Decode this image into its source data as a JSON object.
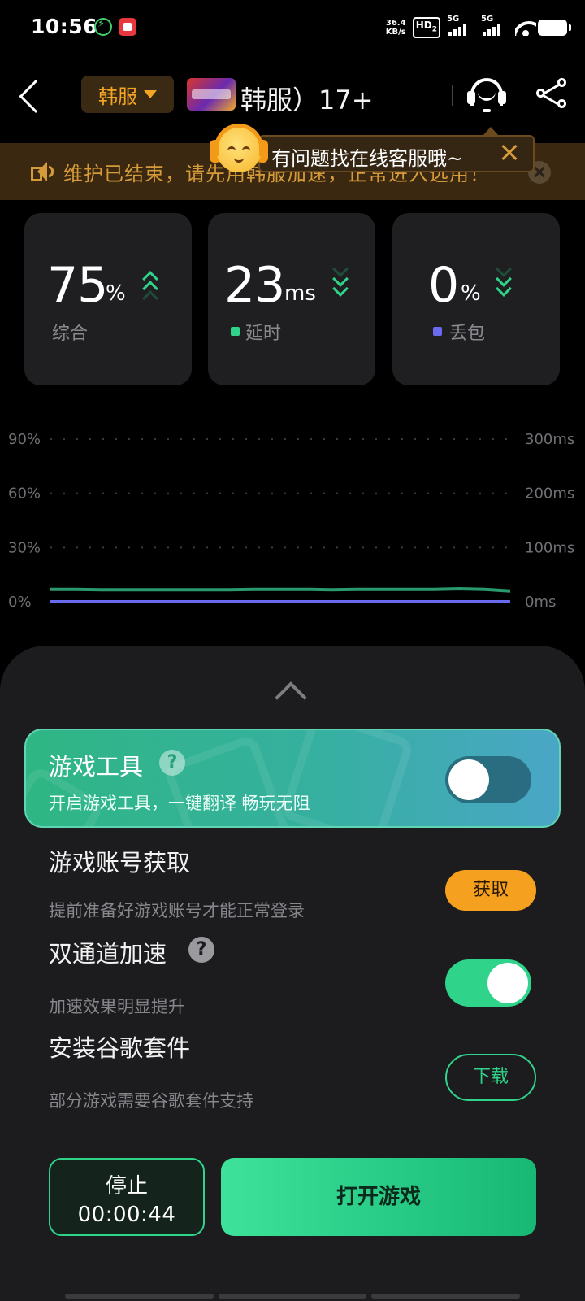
{
  "status_bar": {
    "time": "10:56",
    "net_speed_value": "36.4",
    "net_speed_unit": "KB/s",
    "hd_label": "HD",
    "hd_sub": "2",
    "sim1_label": "5G",
    "sim2_label": "5G"
  },
  "header": {
    "region_label": "韩服",
    "game_title": "韩服）17+",
    "notice_text": "维护已结束，请先用韩服加速，正常进入选用！"
  },
  "tooltip": {
    "text": "有问题找在线客服哦~"
  },
  "stats": [
    {
      "value": "75",
      "unit": "%",
      "label": "综合",
      "trend": "up",
      "color": ""
    },
    {
      "value": "23",
      "unit": "ms",
      "label": "延时",
      "trend": "down",
      "color": "#2fd38a"
    },
    {
      "value": "0",
      "unit": "%",
      "label": "丢包",
      "trend": "down",
      "color": "#6a6af0"
    }
  ],
  "chart_data": {
    "type": "line",
    "left_axis_ticks": [
      "90%",
      "60%",
      "30%",
      "0%"
    ],
    "right_axis_ticks": [
      "300ms",
      "200ms",
      "100ms",
      "0ms"
    ],
    "left_ylim": [
      0,
      90
    ],
    "right_ylim": [
      0,
      300
    ],
    "grid": true,
    "series": [
      {
        "axis": "right",
        "color": "#2a9a6e",
        "values": [
          23,
          23,
          22,
          22,
          22,
          22,
          22,
          22,
          23,
          23,
          23,
          22,
          23,
          23,
          23,
          23,
          24,
          23,
          20
        ]
      },
      {
        "axis": "left",
        "color": "#6a6af0",
        "values": [
          0,
          0,
          0,
          0,
          0,
          0,
          0,
          0,
          0,
          0,
          0,
          0,
          0,
          0,
          0,
          0,
          0,
          0,
          0
        ]
      }
    ]
  },
  "game_tools": {
    "title": "游戏工具",
    "help": "?",
    "subtitle": "开启游戏工具，一键翻译 畅玩无阻",
    "enabled": false
  },
  "account": {
    "title": "游戏账号获取",
    "subtitle": "提前准备好游戏账号才能正常登录",
    "button": "获取"
  },
  "dual_channel": {
    "title": "双通道加速",
    "help": "?",
    "subtitle": "加速效果明显提升",
    "enabled": true
  },
  "google_suite": {
    "title": "安装谷歌套件",
    "subtitle": "部分游戏需要谷歌套件支持",
    "button": "下载"
  },
  "actions": {
    "stop_label": "停止",
    "stop_timer": "00:00:44",
    "open_game": "打开游戏"
  }
}
